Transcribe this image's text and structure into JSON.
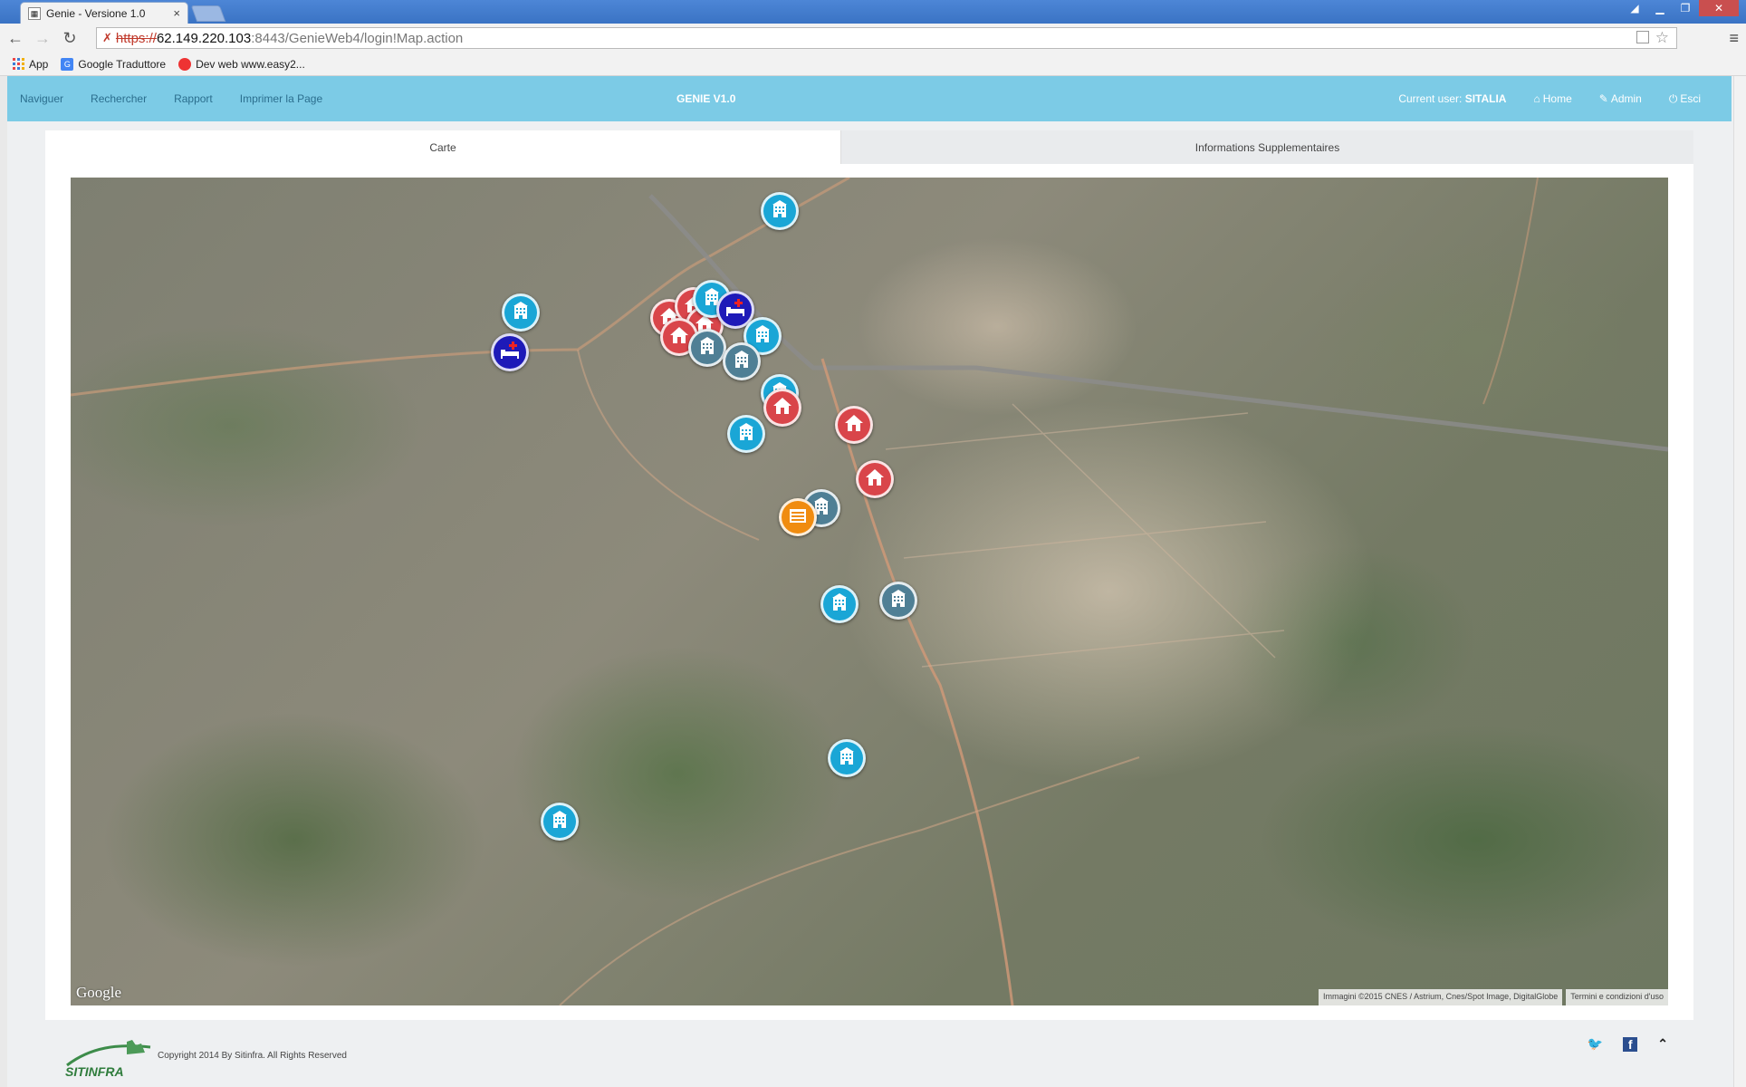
{
  "browser": {
    "tab_title": "Genie - Versione 1.0",
    "tab_close": "×",
    "url_scheme": "https://",
    "url_host": "62.149.220.103",
    "url_path": ":8443/GenieWeb4/login!Map.action",
    "bookmarks": [
      {
        "label": "App",
        "icon": "apps-icon"
      },
      {
        "label": "Google Traduttore",
        "icon": "google-translate-icon"
      },
      {
        "label": "Dev web www.easy2...",
        "icon": "red-circle-icon"
      }
    ]
  },
  "navbar": {
    "items": [
      "Naviguer",
      "Rechercher",
      "Rapport",
      "Imprimer la Page"
    ],
    "brand": "GENIE V1.0",
    "current_user_label": "Current user:",
    "current_user": "SITALIA",
    "home": "Home",
    "admin": "Admin",
    "logout": "Esci"
  },
  "tabs": {
    "active": "Carte",
    "inactive": "Informations Supplementaires"
  },
  "map": {
    "logo": "Google",
    "attribution": "Immagini ©2015 CNES / Astrium, Cnes/Spot Image, DigitalGlobe",
    "terms": "Termini e condizioni d'uso",
    "marker_types": {
      "building": "#1aa6d6",
      "building-dark": "#4f7f95",
      "house": "#d9454a",
      "hospital": "#1e1ab8",
      "school": "#f08c10"
    }
  },
  "footer": {
    "logo_text": "SITINFRA",
    "copyright": "Copyright 2014 By Sitinfra. All Rights Reserved"
  },
  "colors": {
    "navbar": "#7ccbe6",
    "accent": "#1aa6d6"
  }
}
